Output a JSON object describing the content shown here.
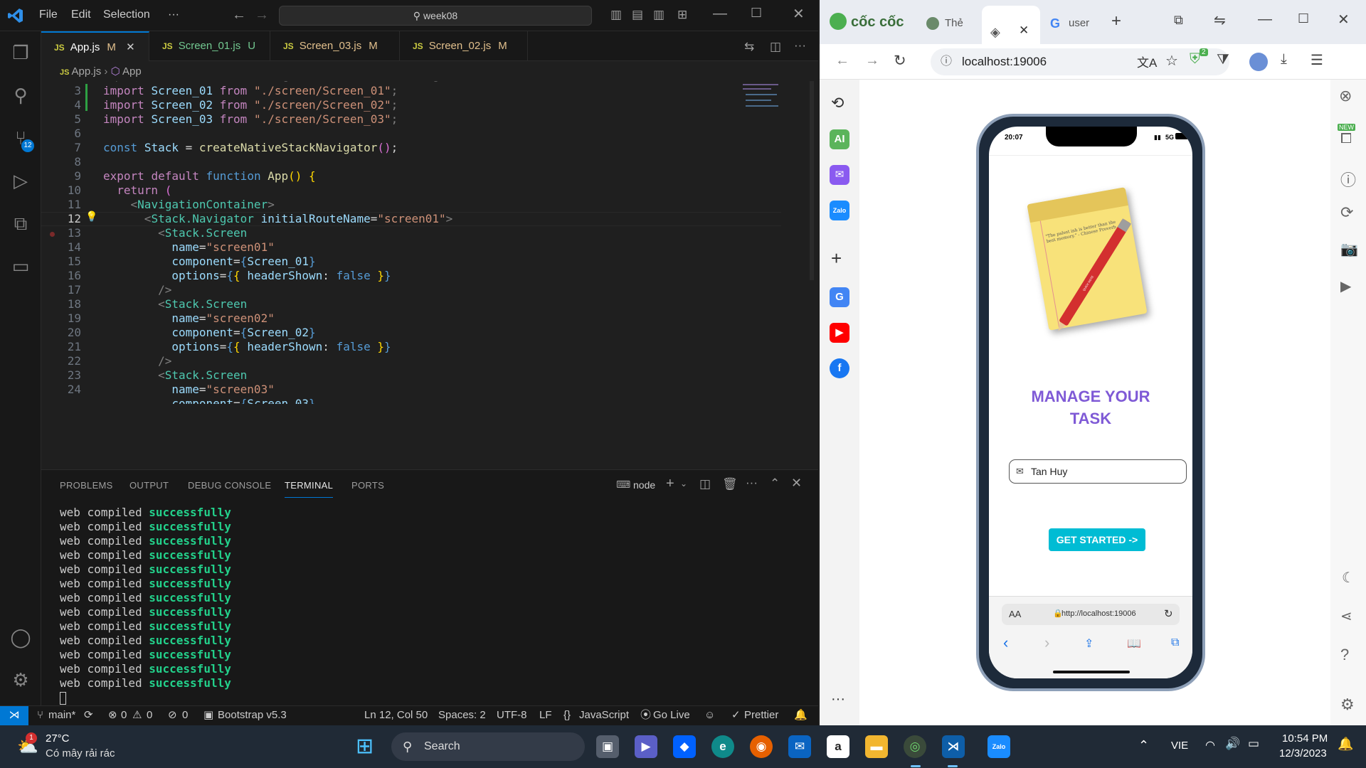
{
  "vscode": {
    "menu": [
      "File",
      "Edit",
      "Selection",
      "···"
    ],
    "search_text": "week08",
    "tabs": [
      {
        "label": "App.js",
        "badge": "M",
        "active": true
      },
      {
        "label": "Screen_01.js",
        "badge": "U"
      },
      {
        "label": "Screen_03.js",
        "badge": "M"
      },
      {
        "label": "Screen_02.js",
        "badge": "M"
      }
    ],
    "breadcrumb": {
      "file": "App.js",
      "symbol": "App"
    },
    "source_control_badge": "12",
    "line_numbers": [
      "3",
      "4",
      "5",
      "6",
      "7",
      "8",
      "9",
      "10",
      "11",
      "12",
      "13",
      "14",
      "15",
      "16",
      "17",
      "18",
      "19",
      "20",
      "21",
      "22",
      "23",
      "24"
    ],
    "panel_tabs": [
      "PROBLEMS",
      "OUTPUT",
      "DEBUG CONSOLE",
      "TERMINAL",
      "PORTS"
    ],
    "terminal_shell": "node",
    "terminal_line": {
      "a": "web",
      "b": "compiled",
      "c": "successfully"
    },
    "status": {
      "branch": "main*",
      "errors": "0",
      "warnings": "0",
      "ports": "0",
      "bootstrap": "Bootstrap v5.3",
      "position": "Ln 12, Col 50",
      "spaces": "Spaces: 2",
      "encoding": "UTF-8",
      "eol": "LF",
      "language": "JavaScript",
      "golive": "Go Live",
      "prettier": "Prettier"
    }
  },
  "browser": {
    "brand": "cốc cốc",
    "tabs": [
      {
        "label": "Thẻ"
      },
      {
        "label": ""
      },
      {
        "label": "user"
      }
    ],
    "url": "localhost:19006",
    "extension_badge": "2",
    "sidebar_ai": "AI",
    "sidebar_zalo": "Zalo",
    "new_badge": "NEW"
  },
  "phone": {
    "time": "20:07",
    "signal": "5G",
    "note_text": "\"The palest ink is better than the best memory.\" - Chinese Proverb",
    "pencil_text": "QUICK NOTE",
    "title_line1": "MANAGE YOUR",
    "title_line2": "TASK",
    "input_value": "Tan Huy",
    "button_label": "GET STARTED ->",
    "safari_aa": "AA",
    "safari_url": "http://localhost:19006"
  },
  "taskbar": {
    "weather_temp": "27°C",
    "weather_desc": "Có mây rải rác",
    "weather_badge": "1",
    "search_label": "Search",
    "language": "VIE",
    "time": "10:54 PM",
    "date": "12/3/2023"
  },
  "colors": {
    "accent_purple": "#7f5ad6",
    "cta_cyan": "#00bcd4",
    "vscode_blue": "#0078d4"
  }
}
